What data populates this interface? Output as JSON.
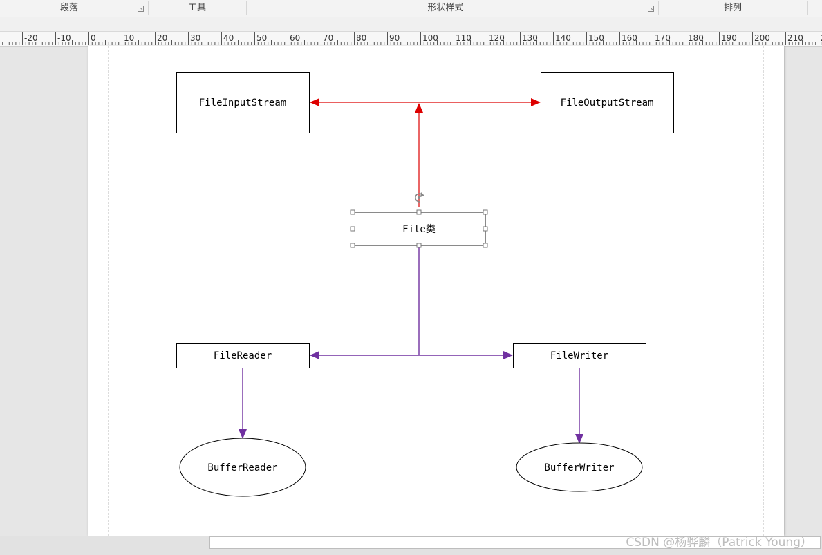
{
  "ribbon": {
    "paragraph": "段落",
    "tools": "工具",
    "shape_styles": "形状样式",
    "arrange": "排列"
  },
  "ruler": {
    "labels": [
      "0",
      "-20",
      "-10",
      "0",
      "10",
      "20",
      "30",
      "40",
      "50",
      "60",
      "70",
      "80",
      "90",
      "100",
      "110",
      "120",
      "130",
      "140",
      "150",
      "160",
      "170",
      "180",
      "190",
      "200",
      "210",
      "2"
    ]
  },
  "diagram": {
    "file_input_stream": "FileInputStream",
    "file_output_stream": "FileOutputStream",
    "file_class": "File类",
    "file_reader": "FileReader",
    "file_writer": "FileWriter",
    "buffer_reader": "BufferReader",
    "buffer_writer": "BufferWriter"
  },
  "colors": {
    "red_arrow": "#dd0000",
    "purple_arrow": "#7030a0"
  },
  "watermark": "CSDN @杨骅麟（Patrick Young）"
}
